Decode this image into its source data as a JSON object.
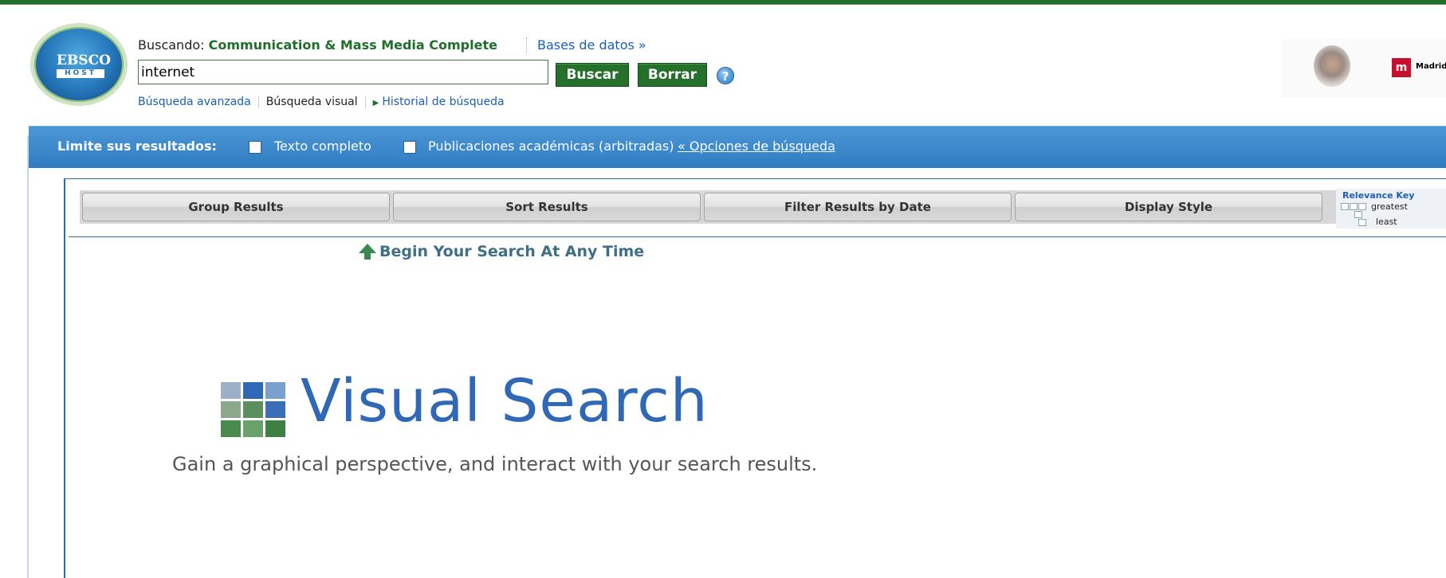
{
  "header": {
    "logo_text": "EBSCO",
    "logo_sub": "HOST",
    "searching_prefix": "Buscando: ",
    "database": "Communication & Mass Media Complete",
    "bases_link": "Bases de datos »",
    "search_value": "internet",
    "buscar_label": "Buscar",
    "borrar_label": "Borrar",
    "help_symbol": "?",
    "links": {
      "advanced": "Búsqueda avanzada",
      "visual": "Búsqueda visual",
      "history": "Historial de búsqueda"
    },
    "madrid_icon": "m",
    "madrid_text": "Madrid"
  },
  "limits": {
    "label": "Limite sus resultados:",
    "fulltext": "Texto completo",
    "scholarly": "Publicaciones académicas (arbitradas)",
    "options_link": "« Opciones de búsqueda"
  },
  "toolbar": {
    "group": "Group Results",
    "sort": "Sort Results",
    "filter": "Filter Results by Date",
    "display": "Display Style"
  },
  "relevance_key": {
    "title": "Relevance Key",
    "greatest": "greatest",
    "least": "least"
  },
  "visual_search": {
    "begin": "Begin Your Search At Any Time",
    "title": "Visual Search",
    "subtitle": "Gain a graphical perspective, and interact with your search results."
  },
  "colors": {
    "brand_green": "#25712c",
    "limit_blue": "#3b88cc",
    "vs_blue": "#2f68b6"
  }
}
